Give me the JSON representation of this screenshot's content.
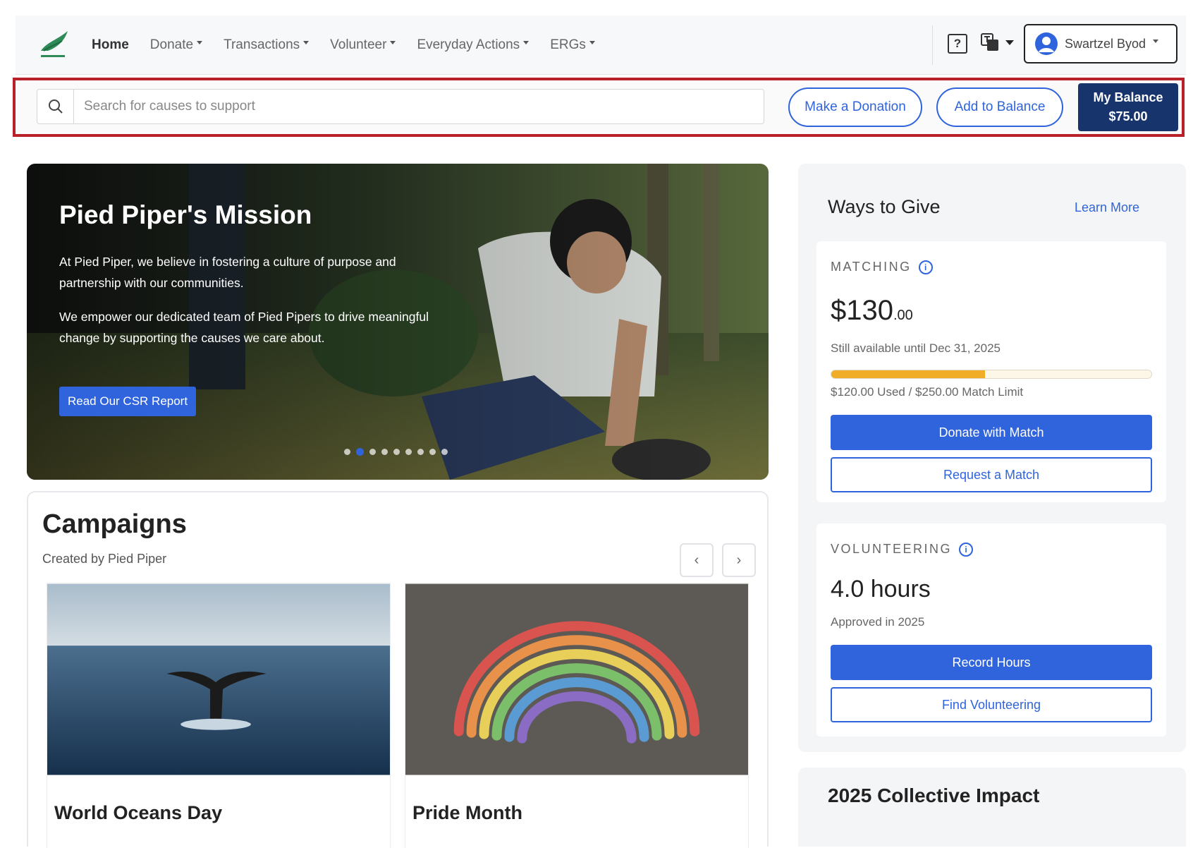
{
  "nav": {
    "items": [
      {
        "label": "Home",
        "dropdown": false
      },
      {
        "label": "Donate",
        "dropdown": true
      },
      {
        "label": "Transactions",
        "dropdown": true
      },
      {
        "label": "Volunteer",
        "dropdown": true
      },
      {
        "label": "Everyday Actions",
        "dropdown": true
      },
      {
        "label": "ERGs",
        "dropdown": true
      }
    ],
    "help_glyph": "?",
    "user_name": "Swartzel Byod"
  },
  "action_bar": {
    "search_placeholder": "Search for causes to support",
    "make_donation": "Make a Donation",
    "add_balance": "Add to Balance",
    "balance_label": "My Balance",
    "balance_value": "$75.00"
  },
  "hero": {
    "title": "Pied Piper's Mission",
    "para1": "At Pied Piper, we believe in fostering a culture of purpose and partnership with our communities.",
    "para2": "We empower our dedicated team of Pied Pipers to drive meaningful change by supporting the causes we care about.",
    "button": "Read Our CSR Report",
    "carousel_total": 9,
    "carousel_active": 2
  },
  "campaigns": {
    "title": "Campaigns",
    "subtitle": "Created by Pied Piper",
    "prev_glyph": "‹",
    "next_glyph": "›",
    "cards": [
      {
        "title": "World Oceans Day"
      },
      {
        "title": "Pride Month"
      }
    ]
  },
  "ways_to_give": {
    "title": "Ways to Give",
    "learn_more": "Learn More",
    "matching": {
      "label": "MATCHING",
      "amount": "$130",
      "cents": ".00",
      "availability": "Still available until Dec 31, 2025",
      "used_fraction": 0.48,
      "usage_text": "$120.00 Used / $250.00 Match Limit",
      "primary_button": "Donate with Match",
      "secondary_button": "Request a Match"
    },
    "volunteering": {
      "label": "VOLUNTEERING",
      "hours": "4.0 hours",
      "approved": "Approved in 2025",
      "primary_button": "Record Hours",
      "secondary_button": "Find Volunteering"
    }
  },
  "impact": {
    "title": "2025 Collective Impact"
  },
  "colors": {
    "primary": "#2f64dd",
    "navy": "#17346d",
    "highlight": "#b8202a",
    "progress": "#f0ad28"
  }
}
